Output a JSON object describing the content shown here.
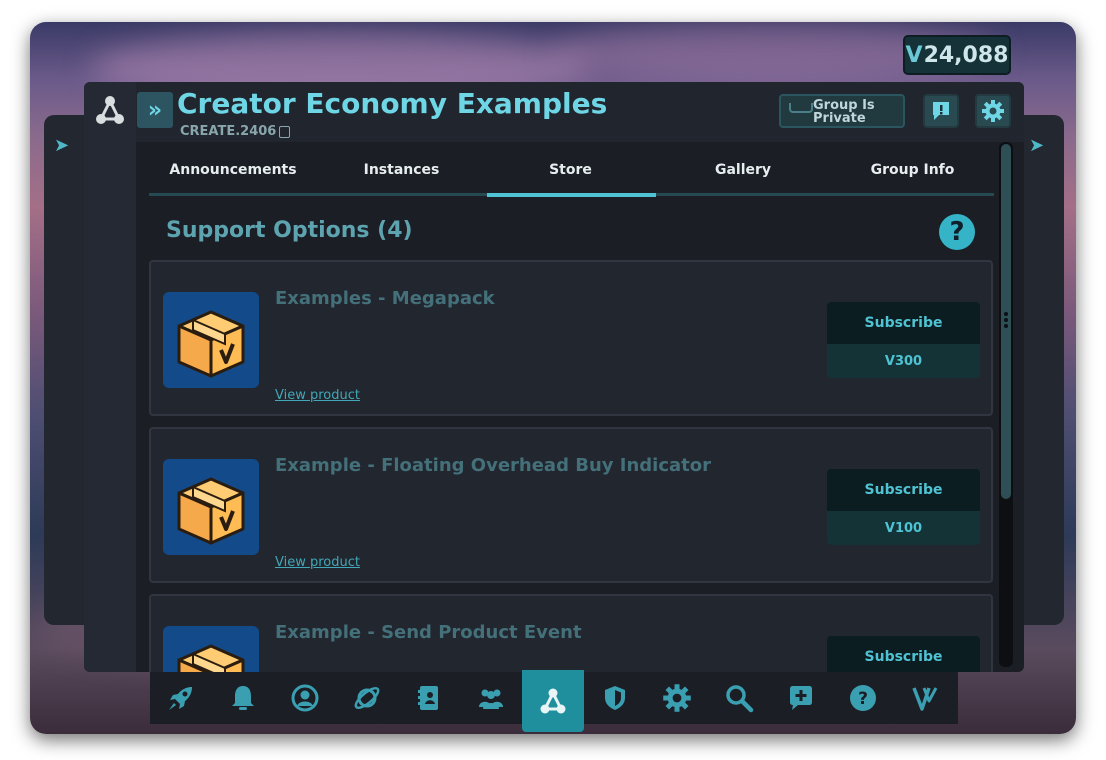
{
  "currency": {
    "symbol": "V",
    "balance": "24,088"
  },
  "header": {
    "title": "Creator Economy Examples",
    "code": "CREATE.2406",
    "privacy_label_line1": "Group Is",
    "privacy_label_line2": "Private"
  },
  "tabs": [
    {
      "label": "Announcements",
      "active": false
    },
    {
      "label": "Instances",
      "active": false
    },
    {
      "label": "Store",
      "active": true
    },
    {
      "label": "Gallery",
      "active": false
    },
    {
      "label": "Group Info",
      "active": false
    }
  ],
  "store": {
    "section_title": "Support Options (4)",
    "products": [
      {
        "name": "Examples - Megapack",
        "action": "Subscribe",
        "price": "V300",
        "link": "View product"
      },
      {
        "name": "Example - Floating Overhead Buy Indicator",
        "action": "Subscribe",
        "price": "V100",
        "link": "View product"
      },
      {
        "name": "Example - Send Product Event",
        "action": "Subscribe",
        "price": "",
        "link": ""
      }
    ]
  },
  "dock": {
    "items": [
      "rocket-icon",
      "bell-icon",
      "profile-icon",
      "planet-icon",
      "notebook-icon",
      "people-icon",
      "groups-icon",
      "shield-icon",
      "gear-icon",
      "search-icon",
      "chat-plus-icon",
      "help-icon",
      "vrchat-icon"
    ],
    "active": "groups-icon"
  },
  "colors": {
    "accent": "#4fc3d3",
    "title": "#6fd6e6",
    "panel": "#1b1e25",
    "active_dock": "#1f8f9e"
  }
}
